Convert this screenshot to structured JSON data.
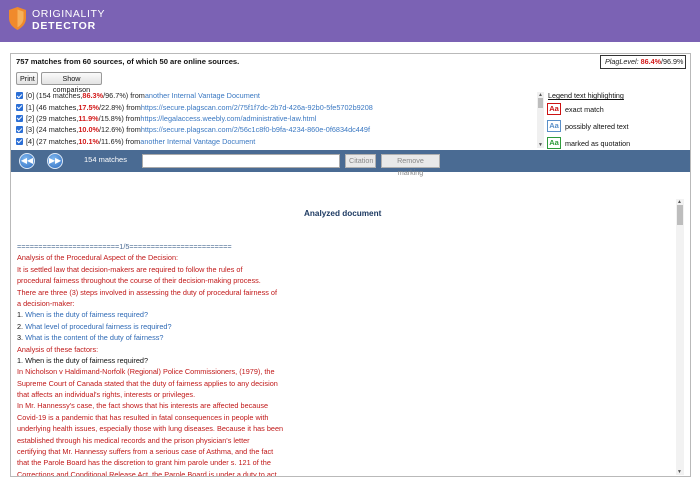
{
  "app": {
    "brand_line1": "ORIGINALITY",
    "brand_line2": "DETECTOR"
  },
  "summary": "757 matches from 60 sources, of which 50 are online sources.",
  "plag": {
    "label": "PlagLevel:",
    "value": "86.4%",
    "secondary": "/96.9%"
  },
  "buttons": {
    "print": "Print",
    "compare": "Show comparison"
  },
  "sources": [
    {
      "prefix": "[0] (154 matches, ",
      "pct": "86.3%",
      "rest": "/96.7%) from ",
      "link": "another Internal Vantage Document"
    },
    {
      "prefix": "[1] (46 matches, ",
      "pct": "17.5%",
      "rest": "/22.8%) from ",
      "link": "https://secure.plagscan.com/2/75f1f7dc-2b7d-426a-92b0-5fe5702b9208"
    },
    {
      "prefix": "[2] (29 matches, ",
      "pct": "11.9%",
      "rest": "/15.8%) from ",
      "link": "https://legalaccess.weebly.com/administrative-law.html"
    },
    {
      "prefix": "[3] (24 matches, ",
      "pct": "10.0%",
      "rest": "/12.6%) from ",
      "link": "https://secure.plagscan.com/2/56c1c8f0-b9fa-4234-860e-0f6834dc449f"
    },
    {
      "prefix": "[4] (27 matches, ",
      "pct": "10.1%",
      "rest": "/11.6%) from ",
      "link": "another Internal Vantage Document"
    }
  ],
  "legend": {
    "title": "Legend text highlighting",
    "icon_text": "Aa",
    "items": [
      {
        "label": "exact match",
        "color": "#cc1111"
      },
      {
        "label": "possibly altered text",
        "color": "#5a8fc8"
      },
      {
        "label": "marked as quotation",
        "color": "#2e9a3a"
      }
    ]
  },
  "toolbar": {
    "prev_icon": "rewind-icon",
    "next_icon": "fast-forward-icon",
    "match_count": "154 matches",
    "search_value": "",
    "citation": "Citation",
    "remove": "Remove marking"
  },
  "document": {
    "title": "Analyzed document",
    "lines": [
      {
        "text": "========================1/5========================",
        "style": "sep"
      },
      {
        "text": "Analysis of the Procedural Aspect of the Decision:",
        "style": "red"
      },
      {
        "text": "It is settled law that decision-makers are required to follow the rules of",
        "style": "red"
      },
      {
        "text": "procedural fairness throughout the course of their decision-making process.",
        "style": "red"
      },
      {
        "text": "There are three (3) steps involved in assessing the duty of procedural fairness of",
        "style": "red"
      },
      {
        "text": "a decision-maker:",
        "style": "red"
      },
      {
        "text": "1. When is the duty of fairness required?",
        "style": "mixed",
        "parts": [
          "1. ",
          "When is the duty of fairness required?"
        ]
      },
      {
        "text": "2. What level of procedural fairness is required?",
        "style": "mixed",
        "parts": [
          "2. ",
          "What level of procedural fairness is required?"
        ]
      },
      {
        "text": "3. What is the content of the duty of fairness?",
        "style": "mixed",
        "parts": [
          "3. ",
          "What is the content of the duty of fairness?"
        ]
      },
      {
        "text": "Analysis of these factors:",
        "style": "red"
      },
      {
        "text": "1. When is the duty of fairness required?",
        "style": "black"
      },
      {
        "text": "In Nicholson v Haldimand-Norfolk (Regional) Police Commissioners, (1979), the",
        "style": "red"
      },
      {
        "text": "Supreme Court of Canada stated that the duty of fairness applies to any decision",
        "style": "red"
      },
      {
        "text": "that affects an individual's rights, interests or privileges.",
        "style": "red"
      },
      {
        "text": "In Mr. Hannessy's case, the fact shows that his interests are affected because",
        "style": "red"
      },
      {
        "text": "Covid-19 is a pandemic that has resulted in fatal consequences in people with",
        "style": "red"
      },
      {
        "text": "underlying health issues, especially those with lung diseases. Because it has been",
        "style": "red"
      },
      {
        "text": "established through his medical records and the prison physician's letter",
        "style": "red"
      },
      {
        "text": "certifying that Mr. Hannessy suffers from a serious case of Asthma, and the fact",
        "style": "red"
      },
      {
        "text": "that the Parole Board has the discretion to grant him parole under s. 121 of the",
        "style": "red"
      },
      {
        "text": "Corrections and Conditional Release Act, the Parole Board is under a duty to act",
        "style": "red"
      }
    ]
  }
}
